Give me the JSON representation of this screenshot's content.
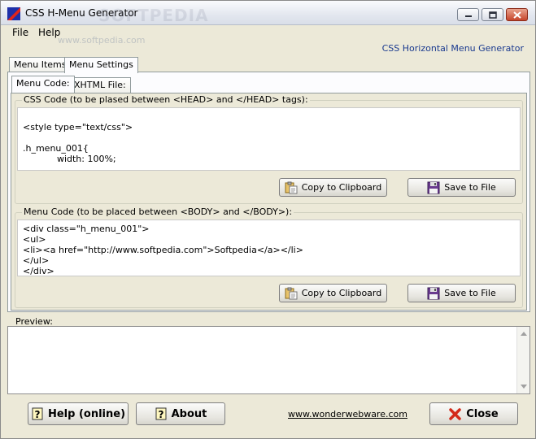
{
  "window": {
    "title": "CSS H-Menu Generator",
    "watermark": "SOFTPEDIA",
    "watermark_url": "www.softpedia.com"
  },
  "menubar": {
    "file": "File",
    "help": "Help"
  },
  "header_label": "CSS Horizontal Menu Generator",
  "outer_tabs": {
    "items": "Menu Items",
    "settings": "Menu Settings"
  },
  "inner_tabs": {
    "menu_code": "Menu Code:",
    "xhtml_file": "XHTML File:"
  },
  "css_group": {
    "legend": "CSS Code (to be plased between <HEAD> and </HEAD> tags):",
    "code": "\n<style type=\"text/css\">\n\n.h_menu_001{\n            width: 100%;",
    "copy_label": "Copy to Clipboard",
    "save_label": "Save to File"
  },
  "menu_group": {
    "legend": "Menu Code (to be placed between <BODY> and </BODY>):",
    "code": "<div class=\"h_menu_001\">\n<ul>\n<li><a href=\"http://www.softpedia.com\">Softpedia</a></li>\n</ul>\n</div>",
    "copy_label": "Copy to Clipboard",
    "save_label": "Save to File"
  },
  "preview": {
    "label": "Preview:"
  },
  "bottom": {
    "help_label": "Help (online)",
    "about_label": "About",
    "link_text": "www.wonderwebware.com",
    "close_label": "Close"
  },
  "colors": {
    "accent_text": "#1a3a8f",
    "close_x": "#d32a1a",
    "window_bg": "#ece9d8"
  }
}
